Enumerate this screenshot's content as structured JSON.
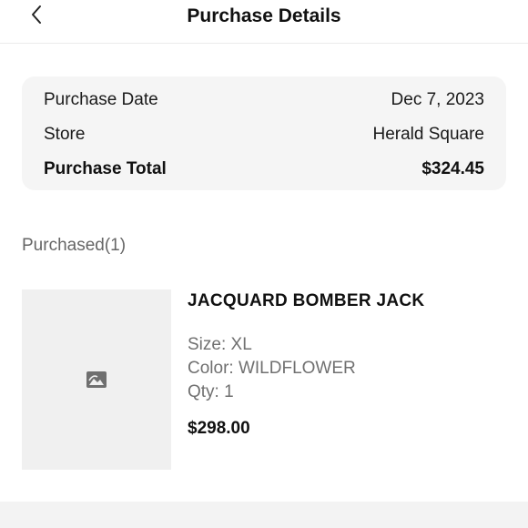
{
  "header": {
    "title": "Purchase Details",
    "back_icon": "chevron-left-icon"
  },
  "summary": {
    "purchase_date_label": "Purchase Date",
    "purchase_date_value": "Dec 7, 2023",
    "store_label": "Store",
    "store_value": "Herald Square",
    "total_label": "Purchase Total",
    "total_value": "$324.45"
  },
  "purchased": {
    "label": "Purchased(1)",
    "items": [
      {
        "image_icon": "image-placeholder-icon",
        "name": "JACQUARD BOMBER JACK",
        "size": "Size: XL",
        "color": "Color: WILDFLOWER",
        "qty": "Qty: 1",
        "price": "$298.00"
      }
    ]
  }
}
